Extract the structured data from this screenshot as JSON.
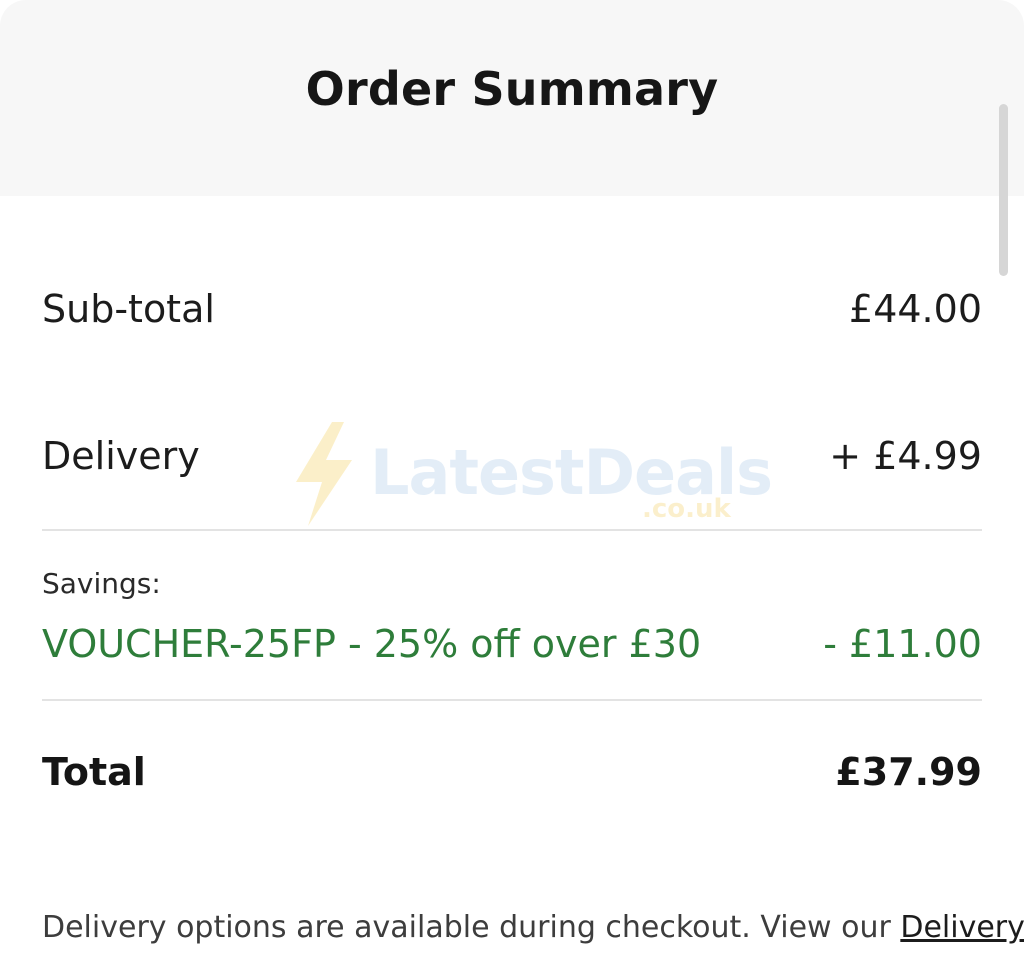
{
  "header": {
    "title": "Order Summary"
  },
  "summary": {
    "subtotal": {
      "label": "Sub-total",
      "amount": "£44.00"
    },
    "delivery": {
      "label": "Delivery",
      "amount": "+ £4.99"
    },
    "savings_heading": "Savings:",
    "voucher": {
      "label": "VOUCHER-25FP - 25% off over £30",
      "amount": "- £11.00"
    },
    "total": {
      "label": "Total",
      "amount": "£37.99"
    }
  },
  "footer": {
    "note": "Delivery options are available during checkout. View our ",
    "link_label": "Delivery"
  },
  "watermark": {
    "brand": "LatestDeals",
    "domain": ".co.uk",
    "icon": "lightning-bolt-icon"
  },
  "colors": {
    "savings_green": "#2e7d3a",
    "header_bg": "#f7f7f7"
  }
}
